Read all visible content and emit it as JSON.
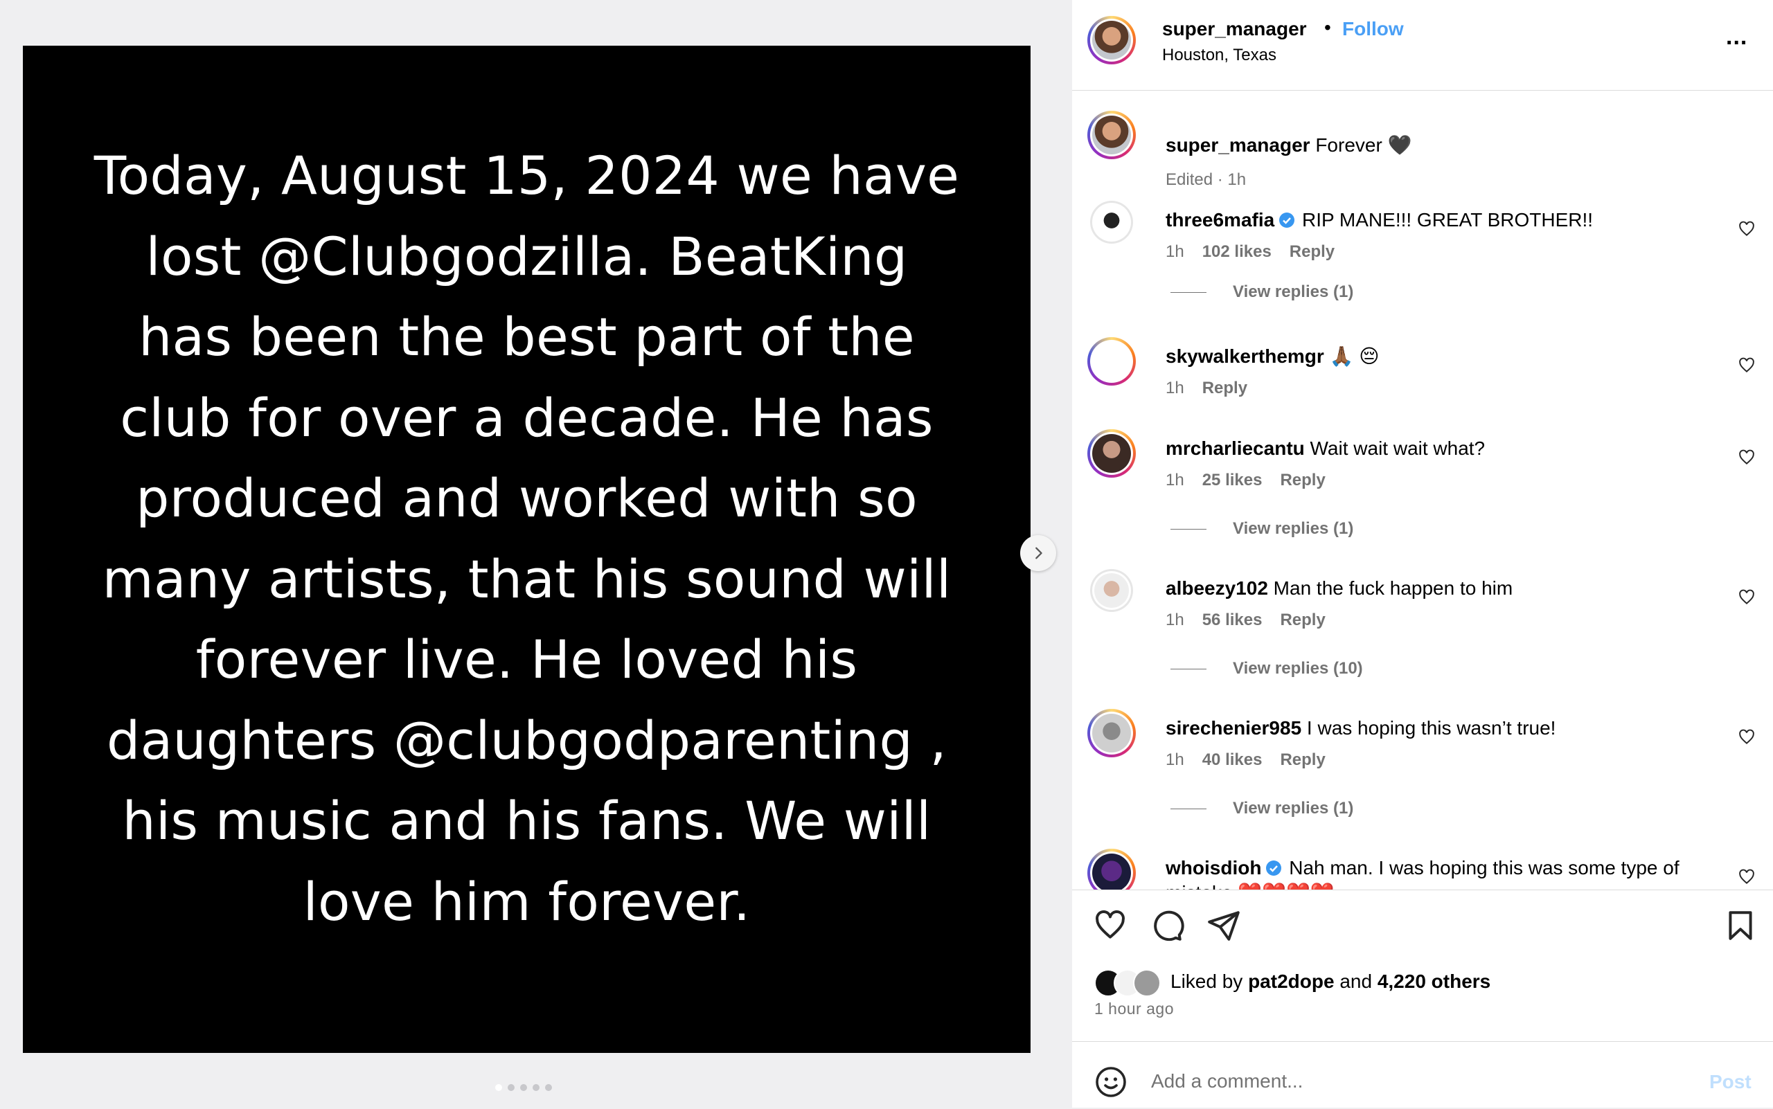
{
  "media": {
    "text": "Today, August 15, 2024 we have\nlost @Clubgodzilla. BeatKing\nhas been the best part of the\nclub for over a decade. He has\nproduced and worked with so\nmany artists, that his sound will\nforever live. He loved his\ndaughters @clubgodparenting ,\nhis music and his fans. We will\nlove him forever.",
    "slides_total": 5,
    "slide_active": 1
  },
  "header": {
    "username": "super_manager",
    "separator": "•",
    "follow_label": "Follow",
    "location": "Houston, Texas",
    "more_label": "..."
  },
  "caption": {
    "username": "super_manager",
    "text": "Forever 🖤",
    "meta": "Edited · 1h"
  },
  "comments": [
    {
      "username": "three6mafia",
      "verified": true,
      "text": "RIP MANE!!! GREAT BROTHER!!",
      "time": "1h",
      "likes": "102 likes",
      "reply": "Reply",
      "view_replies": "View replies (1)"
    },
    {
      "username": "skywalkerthemgr",
      "verified": false,
      "text": "🙏🏾 😔",
      "time": "1h",
      "likes": "",
      "reply": "Reply",
      "view_replies": ""
    },
    {
      "username": "mrcharliecantu",
      "verified": false,
      "text": "Wait wait wait what?",
      "time": "1h",
      "likes": "25 likes",
      "reply": "Reply",
      "view_replies": "View replies (1)"
    },
    {
      "username": "albeezy102",
      "verified": false,
      "text": "Man the fuck happen to him",
      "time": "1h",
      "likes": "56 likes",
      "reply": "Reply",
      "view_replies": "View replies (10)"
    },
    {
      "username": "sirechenier985",
      "verified": false,
      "text": "I was hoping this wasn’t true!",
      "time": "1h",
      "likes": "40 likes",
      "reply": "Reply",
      "view_replies": "View replies (1)"
    },
    {
      "username": "whoisdioh",
      "verified": true,
      "text": "Nah man. I was hoping this was some type of mistake ❤️❤️❤️❤️",
      "time": "",
      "likes": "",
      "reply": "",
      "view_replies": ""
    }
  ],
  "footer": {
    "liked_prefix": "Liked by",
    "liked_user": "pat2dope",
    "liked_and": "and",
    "liked_others": "4,220 others",
    "time_ago": "1 hour ago",
    "comment_placeholder": "Add a comment...",
    "post_label": "Post"
  },
  "colors": {
    "follow": "#4a9ff5",
    "verified": "#3897f0",
    "post_disabled": "#c0dffd",
    "muted": "#737373"
  }
}
